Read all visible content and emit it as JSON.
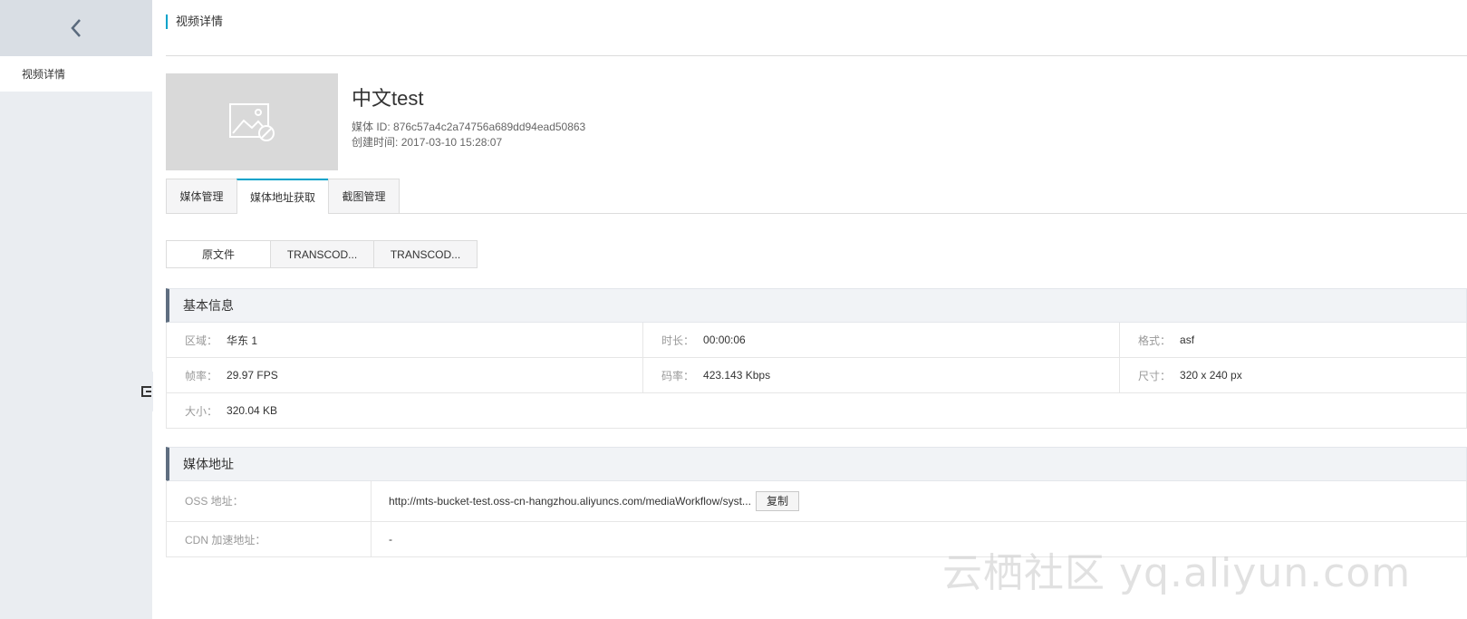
{
  "sidebar": {
    "items": [
      {
        "label": "视频详情"
      }
    ]
  },
  "header": {
    "title": "视频详情"
  },
  "media": {
    "title": "中文test",
    "id_label": "媒体 ID:",
    "id_value": "876c57a4c2a74756a689dd94ead50863",
    "created_label": "创建时间:",
    "created_value": "2017-03-10 15:28:07"
  },
  "tabs": [
    {
      "label": "媒体管理"
    },
    {
      "label": "媒体地址获取"
    },
    {
      "label": "截图管理"
    }
  ],
  "subtabs": [
    {
      "label": "原文件"
    },
    {
      "label": "TRANSCOD..."
    },
    {
      "label": "TRANSCOD..."
    }
  ],
  "basic_info": {
    "title": "基本信息",
    "rows": [
      [
        {
          "label": "区域：",
          "value": "华东 1"
        },
        {
          "label": "时长：",
          "value": "00:00:06"
        },
        {
          "label": "格式：",
          "value": "asf"
        }
      ],
      [
        {
          "label": "帧率：",
          "value": "29.97 FPS"
        },
        {
          "label": "码率：",
          "value": "423.143 Kbps"
        },
        {
          "label": "尺寸：",
          "value": "320 x 240 px"
        }
      ],
      [
        {
          "label": "大小：",
          "value": "320.04 KB"
        }
      ]
    ]
  },
  "media_address": {
    "title": "媒体地址",
    "oss_label": "OSS 地址：",
    "oss_value": "http://mts-bucket-test.oss-cn-hangzhou.aliyuncs.com/mediaWorkflow/syst...",
    "copy_label": "复制",
    "cdn_label": "CDN 加速地址：",
    "cdn_value": "-"
  },
  "watermark": "云栖社区 yq.aliyun.com"
}
